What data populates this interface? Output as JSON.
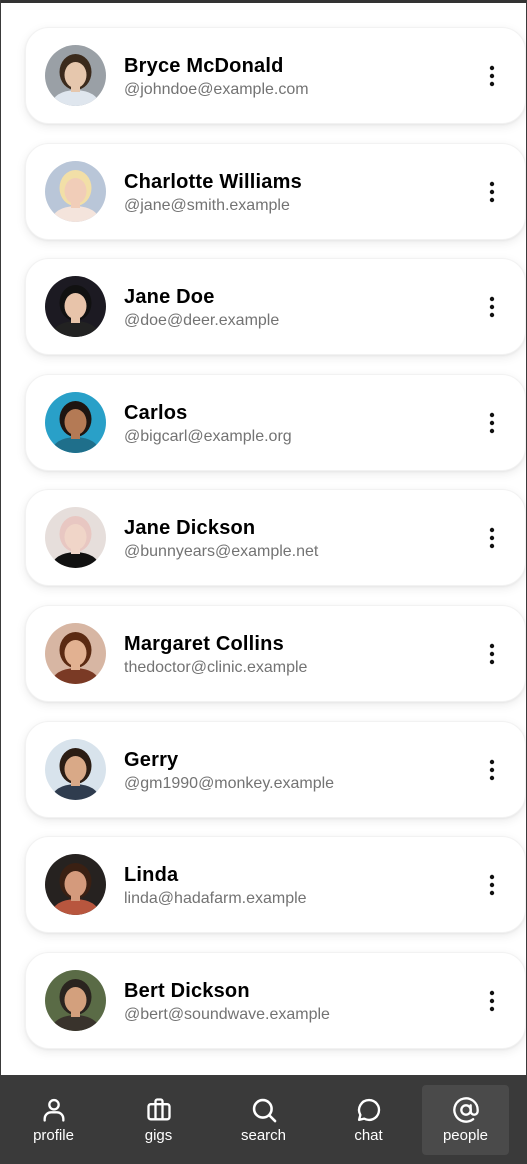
{
  "contacts": [
    {
      "name": "Bryce McDonald",
      "handle": "@johndoe@example.com",
      "skin": "#e6c7ad",
      "hair": "#3b2a1c",
      "bg": "#9aa0a6",
      "shirt": "#dfe6ee"
    },
    {
      "name": "Charlotte Williams",
      "handle": "@jane@smith.example",
      "skin": "#f1cdb8",
      "hair": "#f2dfa7",
      "bg": "#b9c6d8",
      "shirt": "#f4e4dc"
    },
    {
      "name": "Jane Doe",
      "handle": "@doe@deer.example",
      "skin": "#e8c4aa",
      "hair": "#111111",
      "bg": "#1c1a22",
      "shirt": "#222222"
    },
    {
      "name": "Carlos",
      "handle": "@bigcarl@example.org",
      "skin": "#b47a55",
      "hair": "#1e1511",
      "bg": "#29a0c8",
      "shirt": "#1f6f8b"
    },
    {
      "name": "Jane Dickson",
      "handle": "@bunnyears@example.net",
      "skin": "#f0d5c8",
      "hair": "#e8c7c2",
      "bg": "#e6dedb",
      "shirt": "#111111"
    },
    {
      "name": "Margaret Collins",
      "handle": "thedoctor@clinic.example",
      "skin": "#e2b191",
      "hair": "#5b2a12",
      "bg": "#d7b6a3",
      "shirt": "#7a3a25"
    },
    {
      "name": "Gerry",
      "handle": "@gm1990@monkey.example",
      "skin": "#d9a987",
      "hair": "#2b1d14",
      "bg": "#d8e3ec",
      "shirt": "#2f3c4e"
    },
    {
      "name": "Linda",
      "handle": "linda@hadafarm.example",
      "skin": "#d49a7c",
      "hair": "#3a2013",
      "bg": "#262220",
      "shirt": "#b8563e"
    },
    {
      "name": "Bert Dickson",
      "handle": "@bert@soundwave.example",
      "skin": "#d3a07d",
      "hair": "#2a241f",
      "bg": "#5a6b46",
      "shirt": "#39332c"
    }
  ],
  "nav": {
    "profile": "profile",
    "gigs": "gigs",
    "search": "search",
    "chat": "chat",
    "people": "people"
  },
  "colors": {
    "nav_background": "#3a3a3a",
    "nav_active": "#4a4a4a",
    "handle_text": "#737373"
  },
  "icons": {
    "more": "more-vertical-icon",
    "profile": "user-icon",
    "gigs": "briefcase-icon",
    "search": "search-icon",
    "chat": "chat-bubble-icon",
    "people": "at-sign-icon"
  }
}
